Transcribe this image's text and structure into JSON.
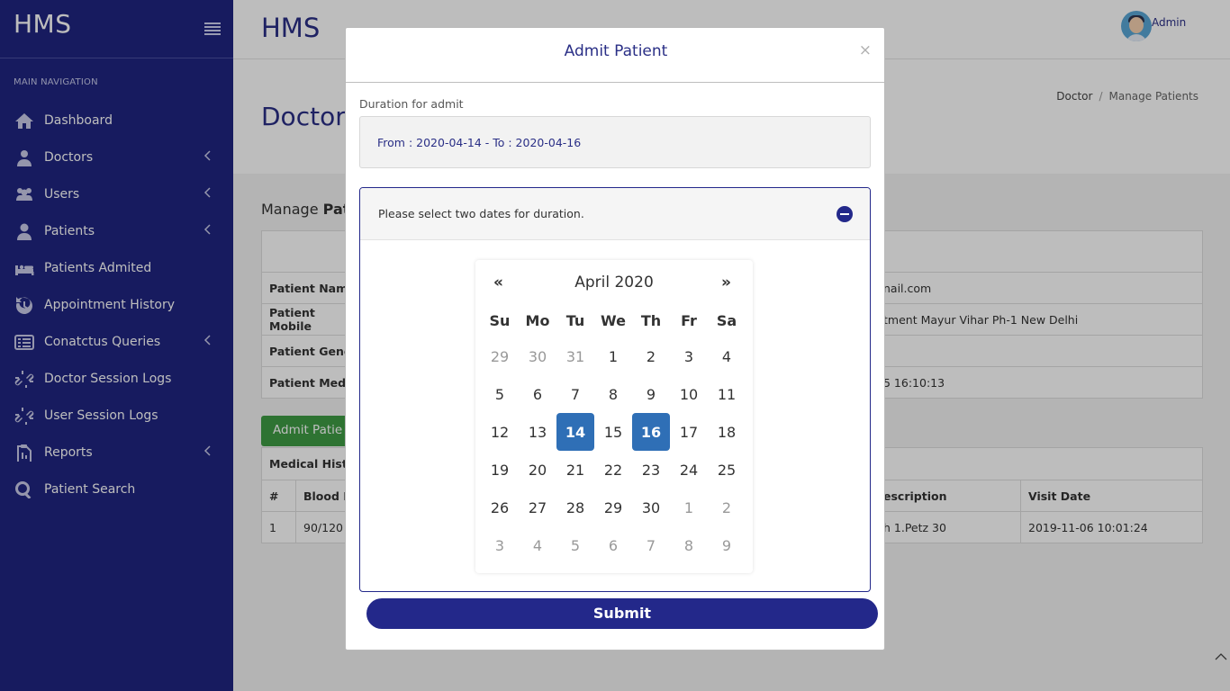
{
  "app": {
    "brand": "HMS",
    "title": "HMS",
    "user": "Admin"
  },
  "sidebar": {
    "heading": "MAIN NAVIGATION",
    "items": [
      {
        "label": "Dashboard",
        "icon": "home-icon",
        "expandable": false
      },
      {
        "label": "Doctors",
        "icon": "doctor-icon",
        "expandable": true
      },
      {
        "label": "Users",
        "icon": "users-icon",
        "expandable": true
      },
      {
        "label": "Patients",
        "icon": "user-icon",
        "expandable": true
      },
      {
        "label": "Patients Admited",
        "icon": "bed-icon",
        "expandable": false
      },
      {
        "label": "Appointment History",
        "icon": "history-icon",
        "expandable": false
      },
      {
        "label": "Conatctus Queries",
        "icon": "list-icon",
        "expandable": true
      },
      {
        "label": "Doctor Session Logs",
        "icon": "link-icon",
        "expandable": false
      },
      {
        "label": "User Session Logs",
        "icon": "link-icon",
        "expandable": false
      },
      {
        "label": "Reports",
        "icon": "report-icon",
        "expandable": true
      },
      {
        "label": "Patient Search",
        "icon": "search-icon",
        "expandable": false
      }
    ]
  },
  "page": {
    "title": "Doctor",
    "breadcrumb": [
      "Doctor",
      "/",
      "Manage Patients"
    ],
    "manage_prefix": "Manage",
    "manage_bold": "Pati",
    "rows": [
      {
        "label": "Patient Name",
        "right": "nail.com"
      },
      {
        "label": "Patient Mobile",
        "right": "tment Mayur Vihar Ph-1 New Delhi"
      },
      {
        "label": "Patient Gende",
        "right": ""
      },
      {
        "label": "Patient Medic",
        "right": "5 16:10:13"
      }
    ],
    "admit_button": "Admit Patie",
    "medical_history": {
      "title": "Medical Histor",
      "headers": [
        "#",
        "Blood P",
        "escription",
        "Visit Date"
      ],
      "rows": [
        [
          "1",
          "90/120",
          "h 1.Petz 30",
          "2019-11-06 10:01:24"
        ]
      ]
    }
  },
  "modal": {
    "title": "Admit Patient",
    "close": "×",
    "field_label": "Duration for admit",
    "date_value": "From : 2020-04-14 - To : 2020-04-16",
    "panel_text": "Please select two dates for duration.",
    "submit": "Submit",
    "calendar": {
      "prev": "«",
      "next": "»",
      "month": "April 2020",
      "dow": [
        "Su",
        "Mo",
        "Tu",
        "We",
        "Th",
        "Fr",
        "Sa"
      ],
      "days": [
        {
          "d": "29",
          "m": true
        },
        {
          "d": "30",
          "m": true
        },
        {
          "d": "31",
          "m": true
        },
        {
          "d": "1"
        },
        {
          "d": "2"
        },
        {
          "d": "3"
        },
        {
          "d": "4"
        },
        {
          "d": "5"
        },
        {
          "d": "6"
        },
        {
          "d": "7"
        },
        {
          "d": "8"
        },
        {
          "d": "9"
        },
        {
          "d": "10"
        },
        {
          "d": "11"
        },
        {
          "d": "12"
        },
        {
          "d": "13"
        },
        {
          "d": "14",
          "s": true
        },
        {
          "d": "15"
        },
        {
          "d": "16",
          "s": true
        },
        {
          "d": "17"
        },
        {
          "d": "18"
        },
        {
          "d": "19"
        },
        {
          "d": "20"
        },
        {
          "d": "21"
        },
        {
          "d": "22"
        },
        {
          "d": "23"
        },
        {
          "d": "24"
        },
        {
          "d": "25"
        },
        {
          "d": "26"
        },
        {
          "d": "27"
        },
        {
          "d": "28"
        },
        {
          "d": "29"
        },
        {
          "d": "30"
        },
        {
          "d": "1",
          "m": true
        },
        {
          "d": "2",
          "m": true
        },
        {
          "d": "3",
          "m": true
        },
        {
          "d": "4",
          "m": true
        },
        {
          "d": "5",
          "m": true
        },
        {
          "d": "6",
          "m": true
        },
        {
          "d": "7",
          "m": true
        },
        {
          "d": "8",
          "m": true
        },
        {
          "d": "9",
          "m": true
        }
      ]
    }
  },
  "colors": {
    "sidebar": "#1f2580",
    "accent": "#2a2f86",
    "selected_day": "#2f6fb6",
    "admit_green": "#3e9b44"
  }
}
